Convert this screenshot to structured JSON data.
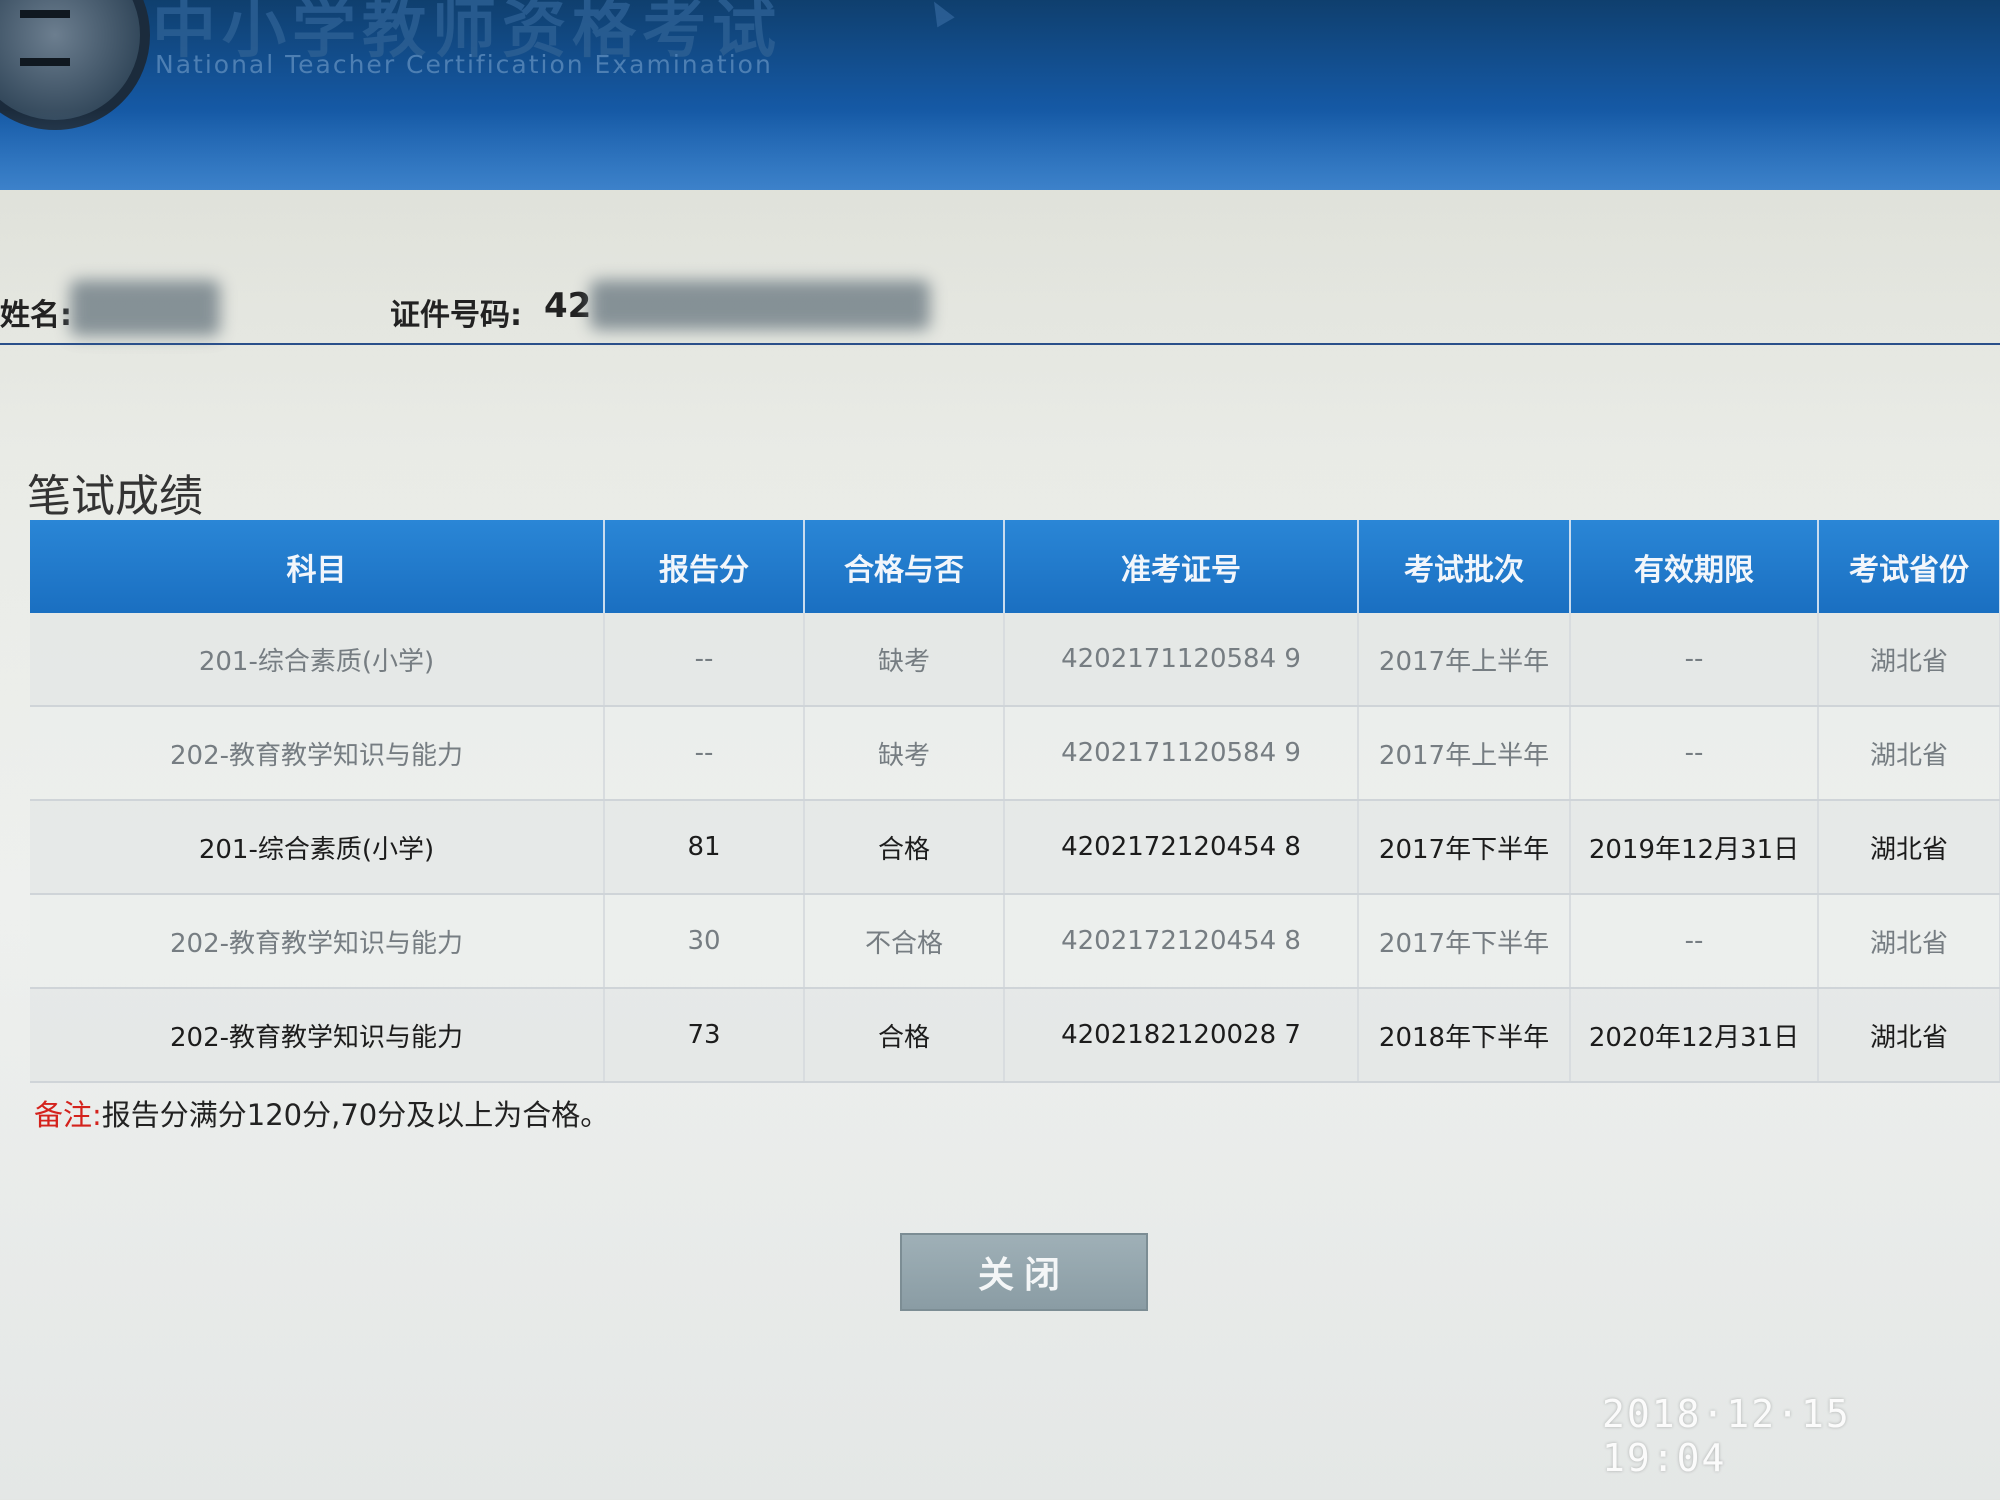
{
  "header": {
    "title": "中小学教师资格考试",
    "subtitle": "National Teacher Certification Examination"
  },
  "candidate": {
    "name_label": "姓名:",
    "id_label": "证件号码:",
    "id_visible_prefix": "42"
  },
  "section": {
    "title": "笔试成绩"
  },
  "table": {
    "headers": [
      "科目",
      "报告分",
      "合格与否",
      "准考证号",
      "考试批次",
      "有效期限",
      "考试省份"
    ],
    "rows": [
      {
        "subject": "201-综合素质(小学)",
        "score": "--",
        "result": "缺考",
        "admission_no": "4202171120584 9",
        "batch": "2017年上半年",
        "valid_until": "--",
        "province": "湖北省"
      },
      {
        "subject": "202-教育教学知识与能力",
        "score": "--",
        "result": "缺考",
        "admission_no": "4202171120584 9",
        "batch": "2017年上半年",
        "valid_until": "--",
        "province": "湖北省"
      },
      {
        "subject": "201-综合素质(小学)",
        "score": "81",
        "result": "合格",
        "admission_no": "4202172120454 8",
        "batch": "2017年下半年",
        "valid_until": "2019年12月31日",
        "province": "湖北省"
      },
      {
        "subject": "202-教育教学知识与能力",
        "score": "30",
        "result": "不合格",
        "admission_no": "4202172120454 8",
        "batch": "2017年下半年",
        "valid_until": "--",
        "province": "湖北省"
      },
      {
        "subject": "202-教育教学知识与能力",
        "score": "73",
        "result": "合格",
        "admission_no": "4202182120028 7",
        "batch": "2018年下半年",
        "valid_until": "2020年12月31日",
        "province": "湖北省"
      }
    ]
  },
  "note": {
    "label": "备注:",
    "text": "报告分满分120分,70分及以上为合格。"
  },
  "buttons": {
    "close_label": "关闭"
  },
  "photo": {
    "timestamp": "2018·12·15 19:04"
  }
}
